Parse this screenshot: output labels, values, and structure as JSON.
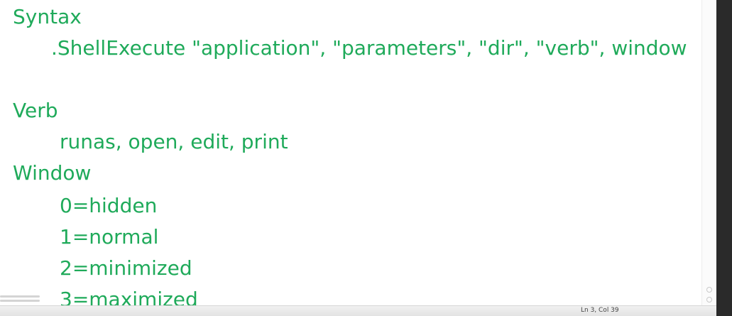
{
  "editor": {
    "lines": [
      "Syntax",
      ".ShellExecute \"application\", \"parameters\", \"dir\", \"verb\", window",
      "",
      "Verb",
      "runas, open, edit, print",
      "Window",
      "0=hidden",
      "1=normal",
      "2=minimized",
      "3=maximized"
    ],
    "text_color": "#1faa5a"
  },
  "status_bar": {
    "position": "Ln 3, Col 39"
  }
}
